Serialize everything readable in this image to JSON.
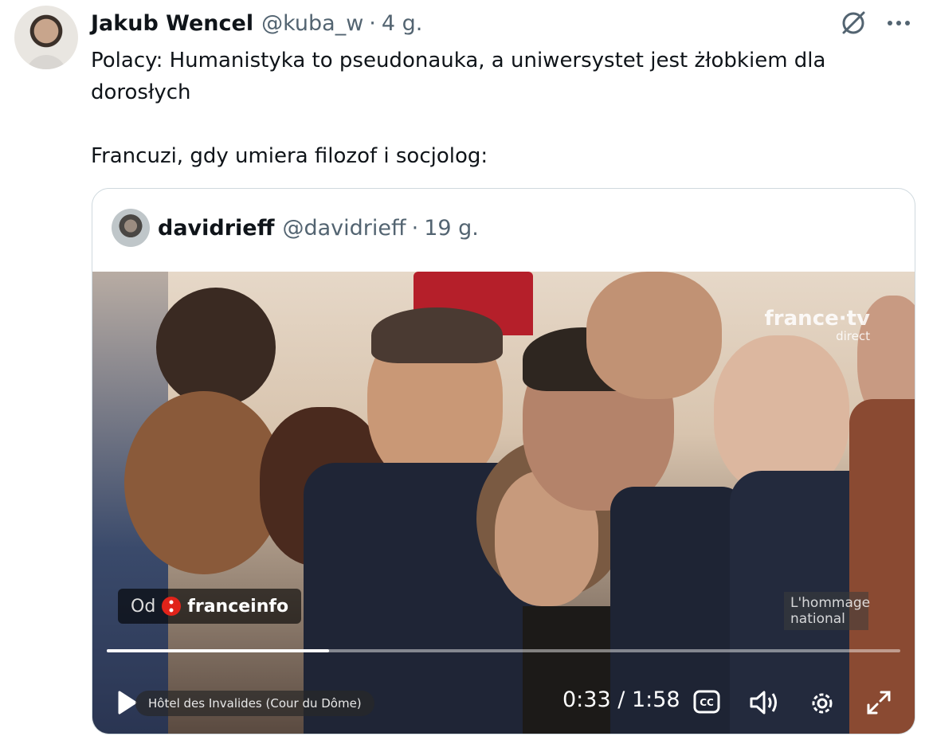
{
  "tweet": {
    "author_name": "Jakub Wencel",
    "author_handle": "@kuba_w",
    "separator": "·",
    "time": "4 g.",
    "paragraph1": "Polacy: Humanistyka to pseudonauka, a uniwersystet jest żłobkiem dla dorosłych",
    "paragraph2": "Francuzi, gdy umiera filozof i socjolog:",
    "icons": [
      "grok-icon",
      "more-icon"
    ]
  },
  "quoted": {
    "author_name": "davidrieff",
    "author_handle": "@davidrieff",
    "separator": "·",
    "time": "19 g."
  },
  "video": {
    "watermark": "france·tv",
    "watermark_sub": "direct",
    "source_prefix": "Od",
    "source_name": "franceinfo",
    "chyron": "Hôtel des Invalides (Cour du Dôme)",
    "corner_caption": "L'hommage national",
    "current_time": "0:33",
    "time_separator": "/",
    "duration": "1:58",
    "progress_fraction": 0.28,
    "icons": [
      "play-icon",
      "captions-icon",
      "volume-icon",
      "settings-icon",
      "fullscreen-icon"
    ]
  }
}
